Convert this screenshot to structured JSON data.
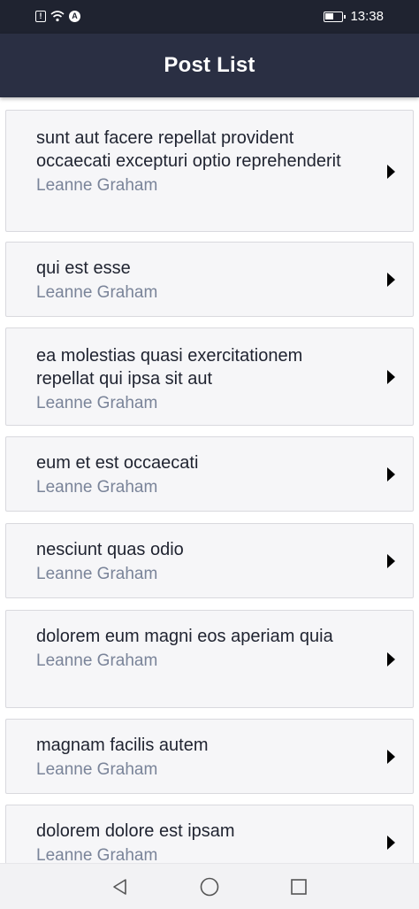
{
  "status_bar": {
    "time": "13:38",
    "battery_level": 0.55,
    "icons": [
      "alert-icon",
      "wifi-icon",
      "app-a-icon",
      "battery-icon"
    ]
  },
  "header": {
    "title": "Post List"
  },
  "posts": [
    {
      "title": "sunt aut facere repellat provident occaecati excepturi optio reprehenderit",
      "author": "Leanne Graham"
    },
    {
      "title": "qui est esse",
      "author": "Leanne Graham"
    },
    {
      "title": "ea molestias quasi exercitationem repellat qui ipsa sit aut",
      "author": "Leanne Graham"
    },
    {
      "title": "eum et est occaecati",
      "author": "Leanne Graham"
    },
    {
      "title": "nesciunt quas odio",
      "author": "Leanne Graham"
    },
    {
      "title": "dolorem eum magni eos aperiam quia",
      "author": "Leanne Graham"
    },
    {
      "title": "magnam facilis autem",
      "author": "Leanne Graham"
    },
    {
      "title": "dolorem dolore est ipsam",
      "author": "Leanne Graham"
    }
  ],
  "nav_bar": {
    "icons": [
      "back-triangle-icon",
      "home-circle-icon",
      "recents-square-icon"
    ]
  },
  "colors": {
    "status_bar": "#1f2330",
    "header": "#2a2f43",
    "card_bg": "#f6f6f8",
    "title_text": "#1f2330",
    "author_text": "#7a8499"
  }
}
